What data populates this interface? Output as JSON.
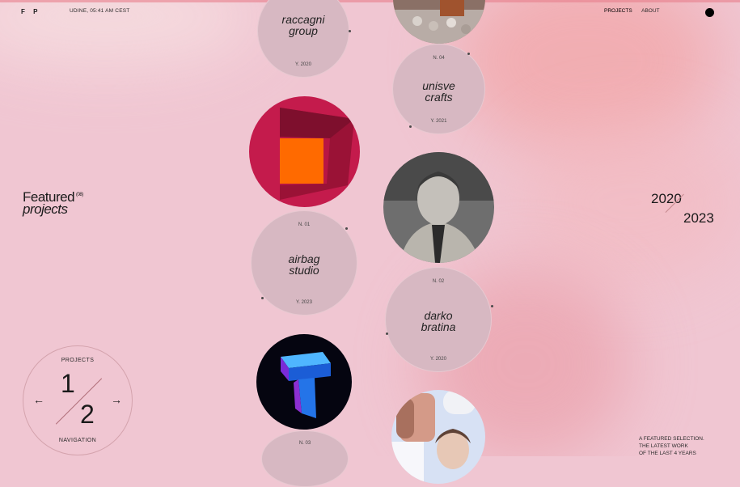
{
  "header": {
    "logo": "F P",
    "location_time": "UDINE, 05:41 AM CEST",
    "nav": [
      "PROJECTS",
      "ABOUT"
    ]
  },
  "featured": {
    "line1": "Featured",
    "count": "(08)",
    "line2": "projects"
  },
  "years": {
    "from": "2020",
    "to": "2023"
  },
  "navigation": {
    "top_label": "PROJECTS",
    "bottom_label": "NAVIGATION",
    "current": "1",
    "total": "2",
    "prev_icon": "←",
    "next_icon": "→"
  },
  "projects": [
    {
      "title_l1": "raccagni",
      "title_l2": "group",
      "year": "Y. 2020"
    },
    {
      "number": "N. 04",
      "title_l1": "unisve",
      "title_l2": "crafts",
      "year": "Y. 2021"
    },
    {
      "number": "N. 01",
      "title_l1": "airbag",
      "title_l2": "studio",
      "year": "Y. 2023"
    },
    {
      "number": "N. 02",
      "title_l1": "darko",
      "title_l2": "bratina",
      "year": "Y. 2020"
    },
    {
      "number": "N. 03"
    }
  ],
  "footer_note": [
    "A FEATURED SELECTION.",
    "THE LATEST WORK",
    "OF THE LAST 4 YEARS"
  ],
  "colors": {
    "accent": "#ff6a00",
    "background": "#f0c6d2",
    "card": "#d7b8c2"
  }
}
